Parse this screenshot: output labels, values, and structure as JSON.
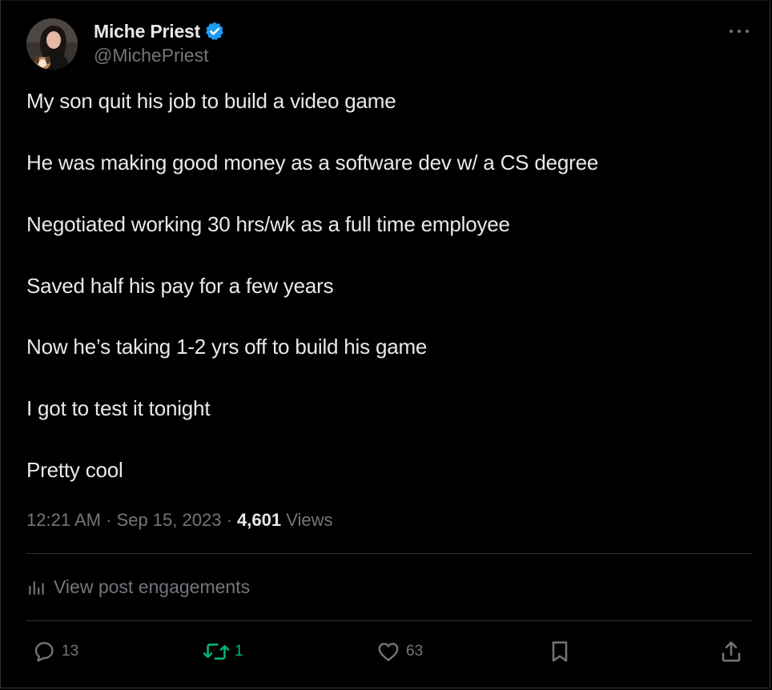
{
  "author": {
    "name": "Miche Priest",
    "handle": "@MichePriest",
    "verified": true
  },
  "tweet": {
    "lines": [
      "My son quit his job to build a video game",
      "He was making good money as a software dev w/ a CS degree",
      "Negotiated working 30 hrs/wk as a full time employee",
      "Saved half his pay for a few years",
      "Now he’s taking 1-2 yrs off to build his game",
      "I got to test it tonight",
      "Pretty cool"
    ]
  },
  "meta": {
    "time": "12:21 AM",
    "date": "Sep 15, 2023",
    "views_count": "4,601",
    "views_label": "Views",
    "separator": "·"
  },
  "engagements_label": "View post engagements",
  "actions": {
    "replies": "13",
    "reposts": "1",
    "likes": "63"
  },
  "colors": {
    "background": "#000000",
    "text": "#e7e9ea",
    "muted": "#71767b",
    "divider": "#2f3336",
    "verified": "#1d9bf0",
    "repost_active": "#00ba7c"
  },
  "icons": {
    "verified": "verified-badge-icon",
    "more": "more-horizontal-icon",
    "analytics": "bar-chart-icon",
    "reply": "reply-bubble-icon",
    "repost": "repost-arrows-icon",
    "like": "heart-icon",
    "bookmark": "bookmark-icon",
    "share": "share-upload-icon"
  }
}
